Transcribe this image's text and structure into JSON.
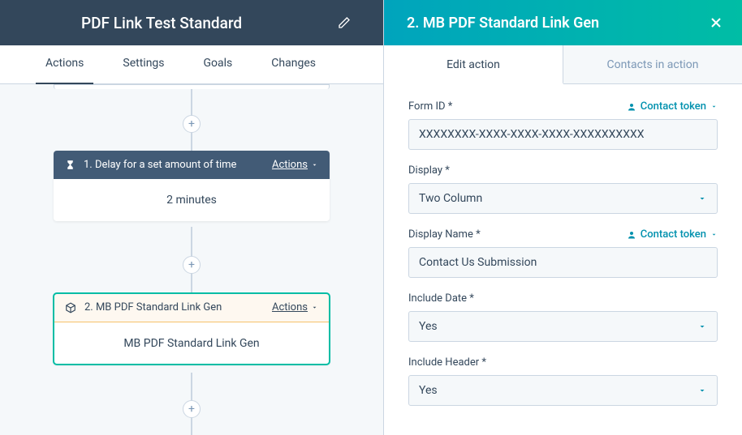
{
  "header": {
    "title": "PDF Link Test Standard"
  },
  "tabs": [
    "Actions",
    "Settings",
    "Goals",
    "Changes"
  ],
  "flow": {
    "node1": {
      "title": "1. Delay for a set amount of time",
      "actions_label": "Actions",
      "body": "2 minutes"
    },
    "node2": {
      "title": "2. MB PDF Standard Link Gen",
      "actions_label": "Actions",
      "body": "MB PDF Standard Link Gen"
    }
  },
  "panel": {
    "title": "2. MB PDF Standard Link Gen",
    "tabs": [
      "Edit action",
      "Contacts in action"
    ],
    "token_label": "Contact token",
    "fields": {
      "form_id": {
        "label": "Form ID *",
        "value": "XXXXXXXX-XXXX-XXXX-XXXX-XXXXXXXXXX"
      },
      "display": {
        "label": "Display *",
        "value": "Two Column"
      },
      "display_name": {
        "label": "Display Name *",
        "value": "Contact Us Submission"
      },
      "include_date": {
        "label": "Include Date *",
        "value": "Yes"
      },
      "include_header": {
        "label": "Include Header *",
        "value": "Yes"
      }
    }
  }
}
